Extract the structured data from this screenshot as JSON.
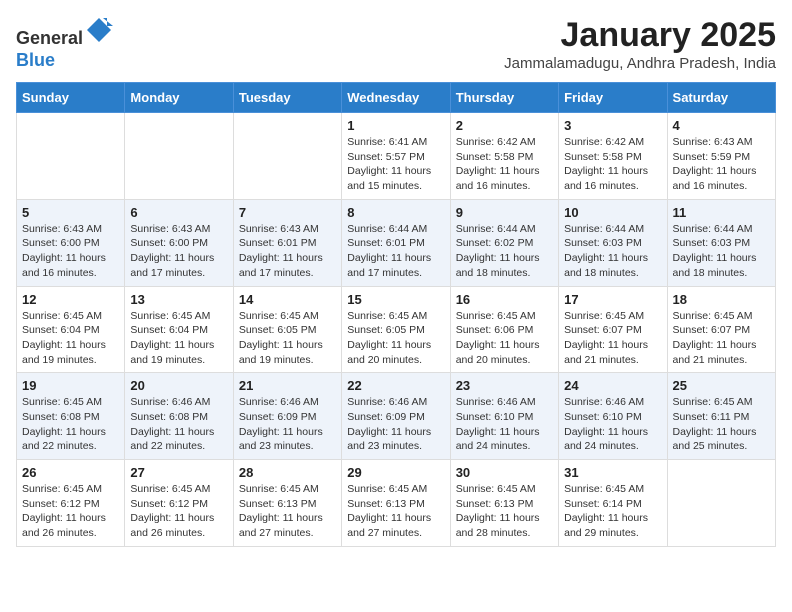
{
  "header": {
    "logo_line1": "General",
    "logo_line2": "Blue",
    "month": "January 2025",
    "location": "Jammalamadugu, Andhra Pradesh, India"
  },
  "days_of_week": [
    "Sunday",
    "Monday",
    "Tuesday",
    "Wednesday",
    "Thursday",
    "Friday",
    "Saturday"
  ],
  "weeks": [
    [
      {
        "day": "",
        "info": ""
      },
      {
        "day": "",
        "info": ""
      },
      {
        "day": "",
        "info": ""
      },
      {
        "day": "1",
        "info": "Sunrise: 6:41 AM\nSunset: 5:57 PM\nDaylight: 11 hours and 15 minutes."
      },
      {
        "day": "2",
        "info": "Sunrise: 6:42 AM\nSunset: 5:58 PM\nDaylight: 11 hours and 16 minutes."
      },
      {
        "day": "3",
        "info": "Sunrise: 6:42 AM\nSunset: 5:58 PM\nDaylight: 11 hours and 16 minutes."
      },
      {
        "day": "4",
        "info": "Sunrise: 6:43 AM\nSunset: 5:59 PM\nDaylight: 11 hours and 16 minutes."
      }
    ],
    [
      {
        "day": "5",
        "info": "Sunrise: 6:43 AM\nSunset: 6:00 PM\nDaylight: 11 hours and 16 minutes."
      },
      {
        "day": "6",
        "info": "Sunrise: 6:43 AM\nSunset: 6:00 PM\nDaylight: 11 hours and 17 minutes."
      },
      {
        "day": "7",
        "info": "Sunrise: 6:43 AM\nSunset: 6:01 PM\nDaylight: 11 hours and 17 minutes."
      },
      {
        "day": "8",
        "info": "Sunrise: 6:44 AM\nSunset: 6:01 PM\nDaylight: 11 hours and 17 minutes."
      },
      {
        "day": "9",
        "info": "Sunrise: 6:44 AM\nSunset: 6:02 PM\nDaylight: 11 hours and 18 minutes."
      },
      {
        "day": "10",
        "info": "Sunrise: 6:44 AM\nSunset: 6:03 PM\nDaylight: 11 hours and 18 minutes."
      },
      {
        "day": "11",
        "info": "Sunrise: 6:44 AM\nSunset: 6:03 PM\nDaylight: 11 hours and 18 minutes."
      }
    ],
    [
      {
        "day": "12",
        "info": "Sunrise: 6:45 AM\nSunset: 6:04 PM\nDaylight: 11 hours and 19 minutes."
      },
      {
        "day": "13",
        "info": "Sunrise: 6:45 AM\nSunset: 6:04 PM\nDaylight: 11 hours and 19 minutes."
      },
      {
        "day": "14",
        "info": "Sunrise: 6:45 AM\nSunset: 6:05 PM\nDaylight: 11 hours and 19 minutes."
      },
      {
        "day": "15",
        "info": "Sunrise: 6:45 AM\nSunset: 6:05 PM\nDaylight: 11 hours and 20 minutes."
      },
      {
        "day": "16",
        "info": "Sunrise: 6:45 AM\nSunset: 6:06 PM\nDaylight: 11 hours and 20 minutes."
      },
      {
        "day": "17",
        "info": "Sunrise: 6:45 AM\nSunset: 6:07 PM\nDaylight: 11 hours and 21 minutes."
      },
      {
        "day": "18",
        "info": "Sunrise: 6:45 AM\nSunset: 6:07 PM\nDaylight: 11 hours and 21 minutes."
      }
    ],
    [
      {
        "day": "19",
        "info": "Sunrise: 6:45 AM\nSunset: 6:08 PM\nDaylight: 11 hours and 22 minutes."
      },
      {
        "day": "20",
        "info": "Sunrise: 6:46 AM\nSunset: 6:08 PM\nDaylight: 11 hours and 22 minutes."
      },
      {
        "day": "21",
        "info": "Sunrise: 6:46 AM\nSunset: 6:09 PM\nDaylight: 11 hours and 23 minutes."
      },
      {
        "day": "22",
        "info": "Sunrise: 6:46 AM\nSunset: 6:09 PM\nDaylight: 11 hours and 23 minutes."
      },
      {
        "day": "23",
        "info": "Sunrise: 6:46 AM\nSunset: 6:10 PM\nDaylight: 11 hours and 24 minutes."
      },
      {
        "day": "24",
        "info": "Sunrise: 6:46 AM\nSunset: 6:10 PM\nDaylight: 11 hours and 24 minutes."
      },
      {
        "day": "25",
        "info": "Sunrise: 6:45 AM\nSunset: 6:11 PM\nDaylight: 11 hours and 25 minutes."
      }
    ],
    [
      {
        "day": "26",
        "info": "Sunrise: 6:45 AM\nSunset: 6:12 PM\nDaylight: 11 hours and 26 minutes."
      },
      {
        "day": "27",
        "info": "Sunrise: 6:45 AM\nSunset: 6:12 PM\nDaylight: 11 hours and 26 minutes."
      },
      {
        "day": "28",
        "info": "Sunrise: 6:45 AM\nSunset: 6:13 PM\nDaylight: 11 hours and 27 minutes."
      },
      {
        "day": "29",
        "info": "Sunrise: 6:45 AM\nSunset: 6:13 PM\nDaylight: 11 hours and 27 minutes."
      },
      {
        "day": "30",
        "info": "Sunrise: 6:45 AM\nSunset: 6:13 PM\nDaylight: 11 hours and 28 minutes."
      },
      {
        "day": "31",
        "info": "Sunrise: 6:45 AM\nSunset: 6:14 PM\nDaylight: 11 hours and 29 minutes."
      },
      {
        "day": "",
        "info": ""
      }
    ]
  ]
}
